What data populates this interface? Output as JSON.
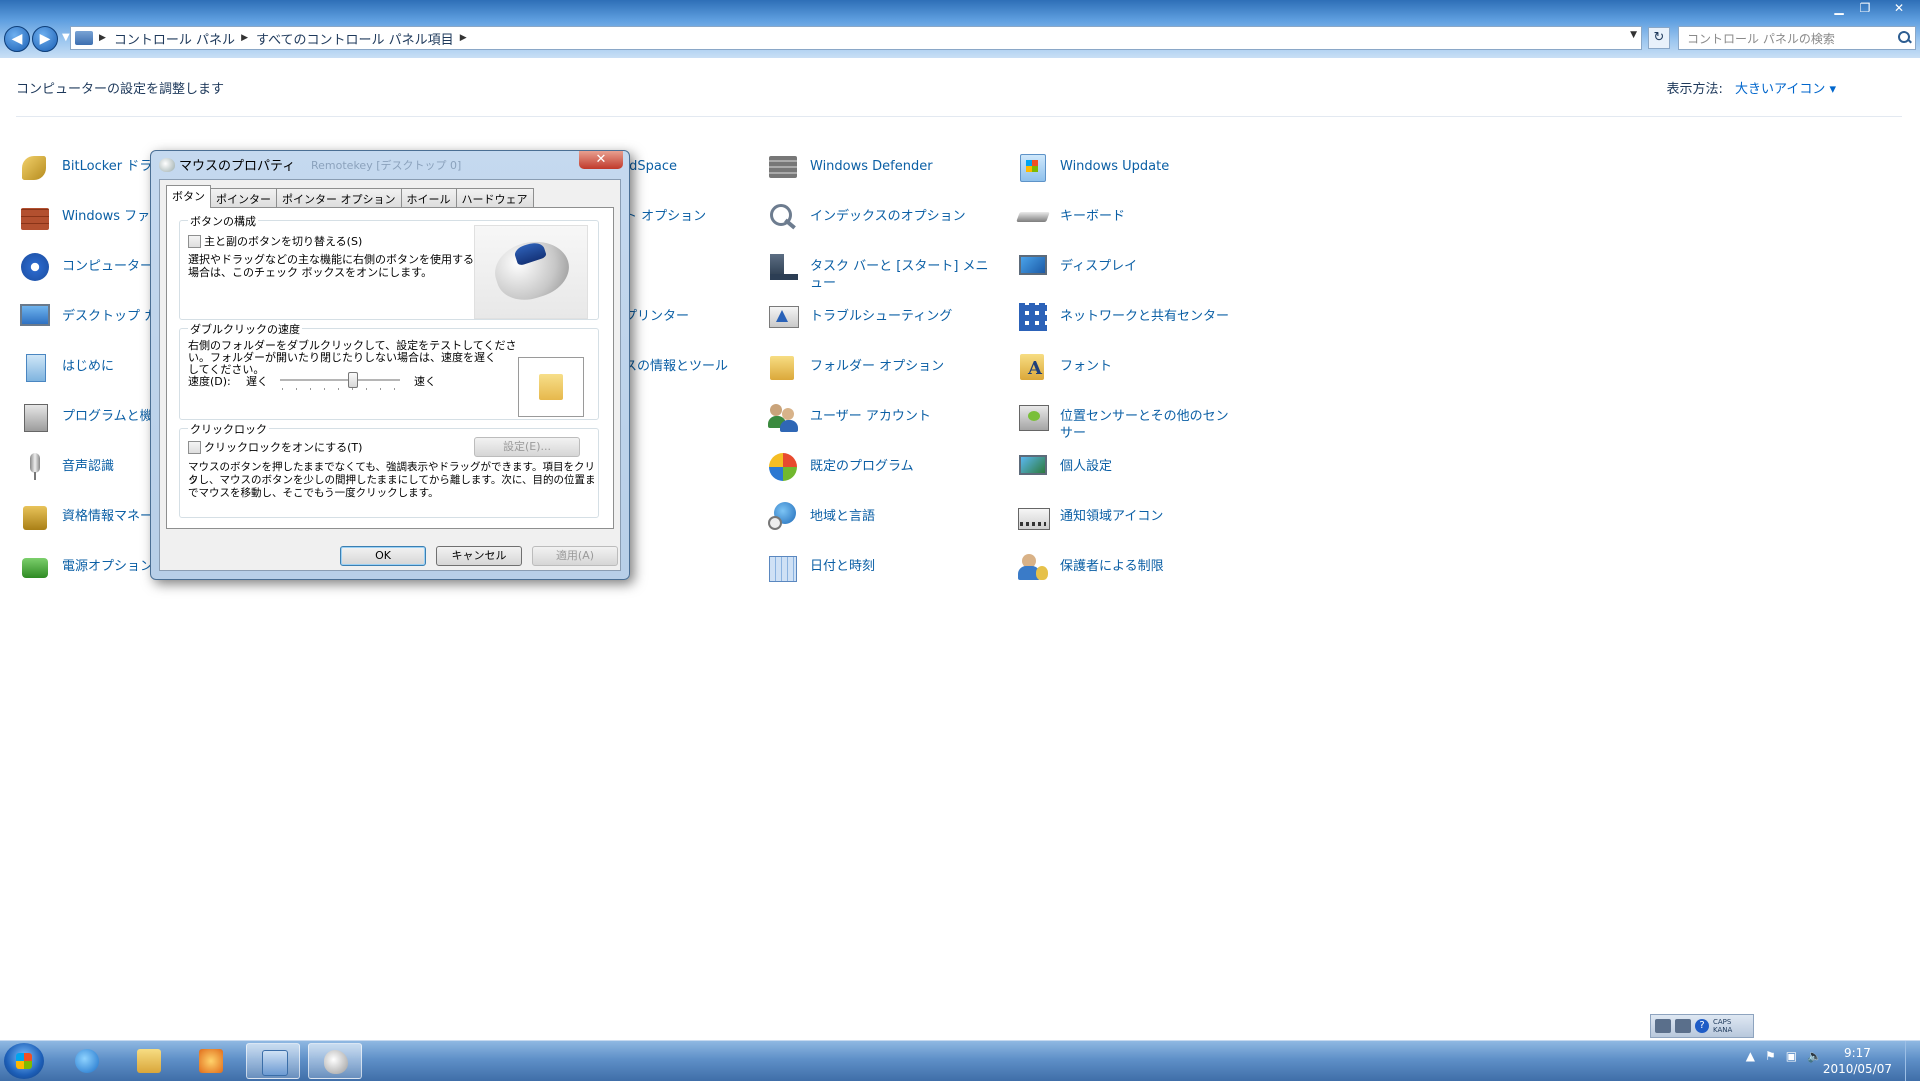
{
  "address": {
    "crumbs": [
      "コントロール パネル",
      "すべてのコントロール パネル項目"
    ],
    "search_placeholder": "コントロール パネルの検索"
  },
  "header": {
    "title": "コンピューターの設定を調整します",
    "view_by_label": "表示方法:",
    "view_by_value": "大きいアイコン"
  },
  "items": {
    "c1": [
      "BitLocker ドラ",
      "Windows ファイ",
      "コンピューター( ー",
      "デスクトップ ガ",
      "はじめに",
      "プログラムと機",
      "音声認識",
      "資格情報マネー",
      "電源オプション"
    ],
    "c3": [
      "rdSpace",
      "ト オプション",
      "",
      "プリンター",
      "スの情報とツール"
    ],
    "c4": [
      "Windows Defender",
      "インデックスのオプション",
      "タスク バーと [スタート] メニュー",
      "トラブルシューティング",
      "フォルダー オプション",
      "ユーザー アカウント",
      "既定のプログラム",
      "地域と言語",
      "日付と時刻"
    ],
    "c5": [
      "Windows Update",
      "キーボード",
      "ディスプレイ",
      "ネットワークと共有センター",
      "フォント",
      "位置センサーとその他のセンサー",
      "個人設定",
      "通知領域アイコン",
      "保護者による制限"
    ]
  },
  "dialog": {
    "title": "マウスのプロパティ",
    "ghost_title": "Remotekey [デスクトップ 0]",
    "tabs": [
      "ボタン",
      "ポインター",
      "ポインター オプション",
      "ホイール",
      "ハードウェア"
    ],
    "button_config": {
      "title": "ボタンの構成",
      "checkbox": "主と副のボタンを切り替える(S)",
      "desc1": "選択やドラッグなどの主な機能に右側のボタンを使用する",
      "desc2": "場合は、このチェック ボックスをオンにします。"
    },
    "double_click": {
      "title": "ダブルクリックの速度",
      "desc1": "右側のフォルダーをダブルクリックして、設定をテストしてくださ",
      "desc2": "い。フォルダーが開いたり閉じたりしない場合は、速度を遅く",
      "desc3": "してください。",
      "speed_label": "速度(D):",
      "slow": "遅く",
      "fast": "速く",
      "level": 0.6
    },
    "click_lock": {
      "title": "クリックロック",
      "checkbox": "クリックロックをオンにする(T)",
      "settings": "設定(E)...",
      "desc1": "マウスのボタンを押したままでなくても、強調表示やドラッグができます。項目をクリッ",
      "desc2": "クし、マウスのボタンを少しの間押したままにしてから離します。次に、目的の位置ま",
      "desc3": "でマウスを移動し、そこでもう一度クリックします。"
    },
    "ok": "OK",
    "cancel": "キャンセル",
    "apply": "適用(A)"
  },
  "taskbar": {
    "ime_caps": "CAPS",
    "ime_kana": "KANA",
    "time": "9:17",
    "date": "2010/05/07"
  }
}
